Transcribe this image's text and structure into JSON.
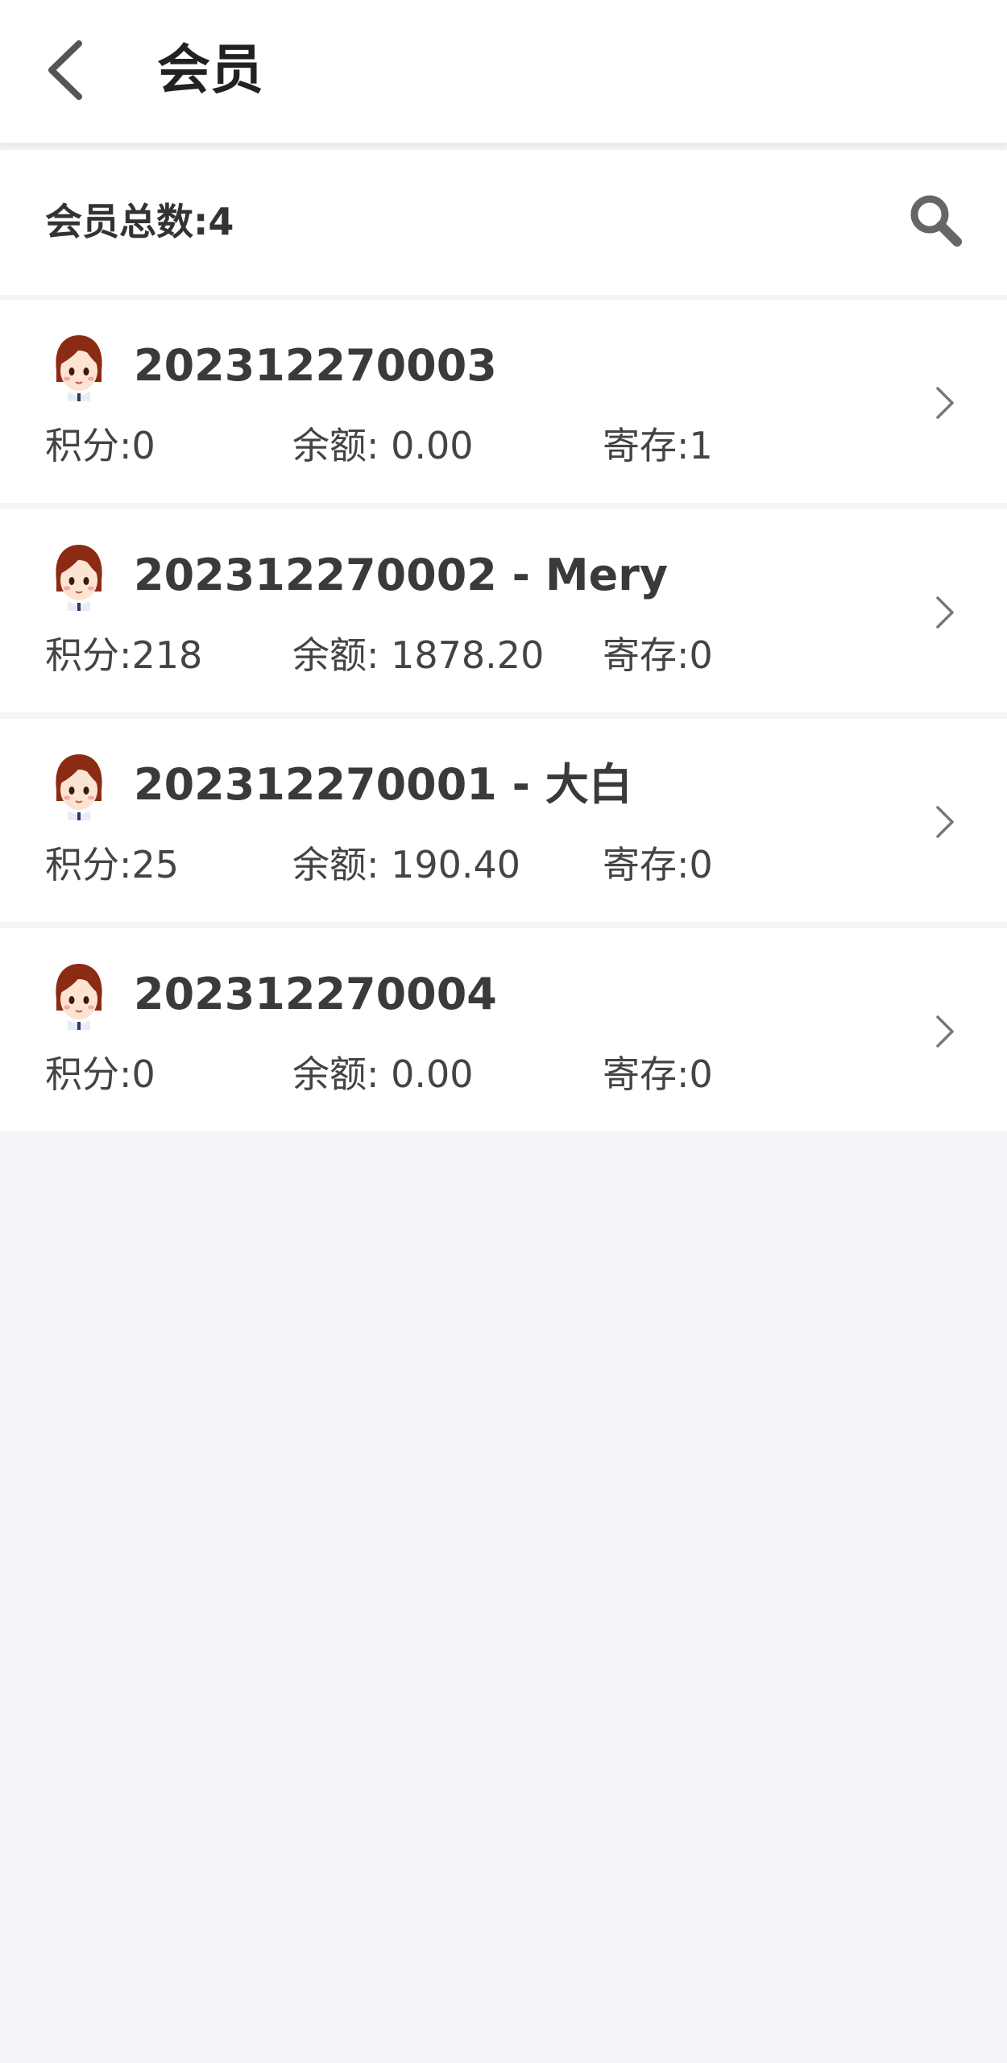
{
  "header": {
    "title": "会员",
    "back_icon": "back-arrow-icon"
  },
  "summary": {
    "total_text": "会员总数:4",
    "search_icon": "search-icon"
  },
  "colors": {
    "background": "#f4f4f9",
    "card": "#ffffff",
    "text": "#333333",
    "icon": "#666666"
  },
  "members": [
    {
      "name": "202312270003",
      "points": "积分:0",
      "balance": "余额: 0.00",
      "storage": "寄存:1"
    },
    {
      "name": "202312270002 - Mery",
      "points": "积分:218",
      "balance": "余额: 1878.20",
      "storage": "寄存:0"
    },
    {
      "name": "202312270001 - 大白",
      "points": "积分:25",
      "balance": "余额: 190.40",
      "storage": "寄存:0"
    },
    {
      "name": "202312270004",
      "points": "积分:0",
      "balance": "余额: 0.00",
      "storage": "寄存:0"
    }
  ]
}
